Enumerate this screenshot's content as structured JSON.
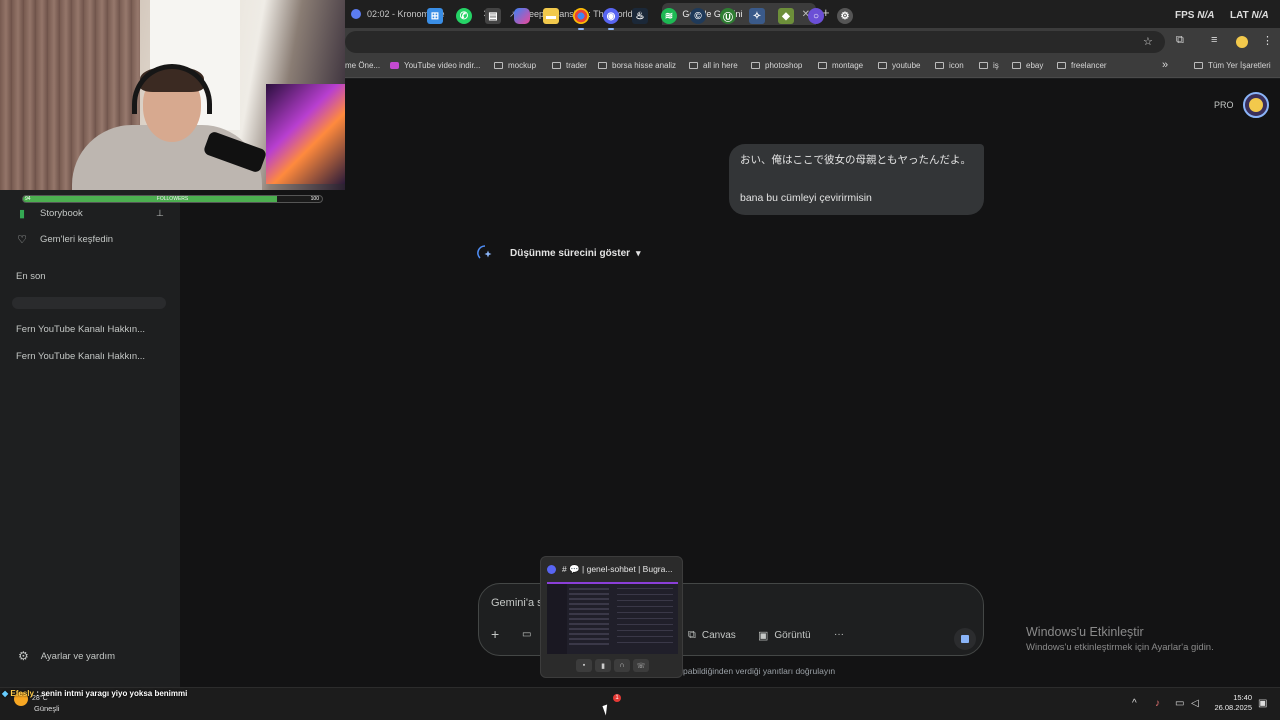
{
  "browser": {
    "tabs": [
      {
        "title": "02:02 - Kronometre",
        "icon_color": "#5b7cf0",
        "active": false
      },
      {
        "title": "DeepL Translate: The world's m",
        "icon_color": "#3b7bd6",
        "active": false
      },
      {
        "title": "Google Gemini",
        "icon_color": "#8ab4f8",
        "active": true
      }
    ],
    "new_tab": "+",
    "close_glyph": "✕",
    "overlay": {
      "fps_label": "FPS",
      "fps_value": "N/A",
      "lat_label": "LAT",
      "lat_value": "N/A"
    },
    "bookmarks": [
      "me Öne...",
      "YouTube video indir...",
      "mockup",
      "trader",
      "borsa hisse analiz",
      "all in here",
      "photoshop",
      "montage",
      "youtube",
      "icon",
      "iş",
      "ebay",
      "freelancer"
    ],
    "bookmarks_more": "»",
    "all_bookmarks": "Tüm Yer İşaretleri"
  },
  "sidebar": {
    "items": [
      {
        "label": "Storybook",
        "icon": "book-icon"
      },
      {
        "label": "Gem'leri keşfedin",
        "icon": "gem-icon"
      }
    ],
    "recent_heading": "En son",
    "recent": [
      "Fern YouTube Kanalı Hakkın...",
      "Fern YouTube Kanalı Hakkın..."
    ],
    "settings_label": "Ayarlar ve yardım"
  },
  "header": {
    "pro_label": "PRO"
  },
  "conversation": {
    "user_message_line1": "おい、俺はここで彼女の母親ともヤったんだよ。",
    "user_message_line2": "bana bu cümleyi çevirirmisin",
    "thinking_label": "Düşünme sürecini göster"
  },
  "composer": {
    "placeholder_partial": "Gemini'a s",
    "tools": [
      "Canvas",
      "Görüntü"
    ],
    "more": "···",
    "disclaimer_partial": "pabildiğinden verdiği yanıtları doğrulayın"
  },
  "windows_activation": {
    "title": "Windows'u Etkinleştir",
    "subtitle": "Windows'u etkinleştirmek için Ayarlar'a gidin."
  },
  "stream_overlay": {
    "follow_goal_min": "94",
    "follow_goal_label": "FOLLOWERS",
    "follow_goal_max": "100",
    "follow_progress": 0.85,
    "chat_user": "Efesly",
    "chat_message": " : senin intmi yaragı yiyo yoksa benimmi"
  },
  "taskbar_preview": {
    "title": "# 💬 | genel-sohbet | Bugra..."
  },
  "taskbar": {
    "weather_temp": "28°C",
    "weather_cond": "Güneşli",
    "discord_badge": "1",
    "time": "15:40",
    "date": "26.08.2025"
  },
  "colors": {
    "accent": "#8ab4f8",
    "page_bg": "#131314",
    "sidebar_bg": "#1e1f20",
    "bubble_bg": "#333537"
  }
}
